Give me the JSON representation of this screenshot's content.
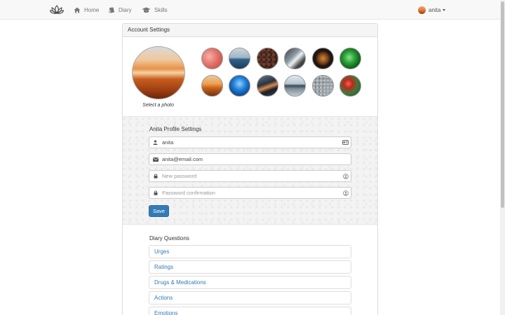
{
  "nav": {
    "logo_icon": "lotus-icon",
    "items": [
      {
        "label": "Home",
        "icon": "home-icon"
      },
      {
        "label": "Diary",
        "icon": "book-icon"
      },
      {
        "label": "Skills",
        "icon": "graduation-cap-icon"
      }
    ],
    "user": {
      "name": "anita"
    }
  },
  "panel": {
    "title": "Account Settings"
  },
  "photos": {
    "caption": "Select a photo",
    "thumbs": [
      {
        "name": "pink-flowers"
      },
      {
        "name": "ocean-horizon"
      },
      {
        "name": "coffee-beans"
      },
      {
        "name": "waterfall-rocks"
      },
      {
        "name": "coffee-cup"
      },
      {
        "name": "green-leaf"
      },
      {
        "name": "desert-sunset"
      },
      {
        "name": "blue-water"
      },
      {
        "name": "highway-night"
      },
      {
        "name": "lake-mountains"
      },
      {
        "name": "pebbles"
      },
      {
        "name": "red-flower"
      }
    ]
  },
  "profile": {
    "title": "Anita Profile Settings",
    "username_value": "anita",
    "email_value": "anita@email.com",
    "password_placeholder": "New password",
    "confirm_placeholder": "Password confirmation",
    "save_label": "Save"
  },
  "diary": {
    "title": "Diary Questions",
    "items": [
      "Urges",
      "Ratings",
      "Drugs & Medications",
      "Actions",
      "Emotions"
    ]
  },
  "colors": {
    "primary": "#337ab7",
    "link": "#337ab7",
    "navbar_bg": "#f8f8f8"
  }
}
